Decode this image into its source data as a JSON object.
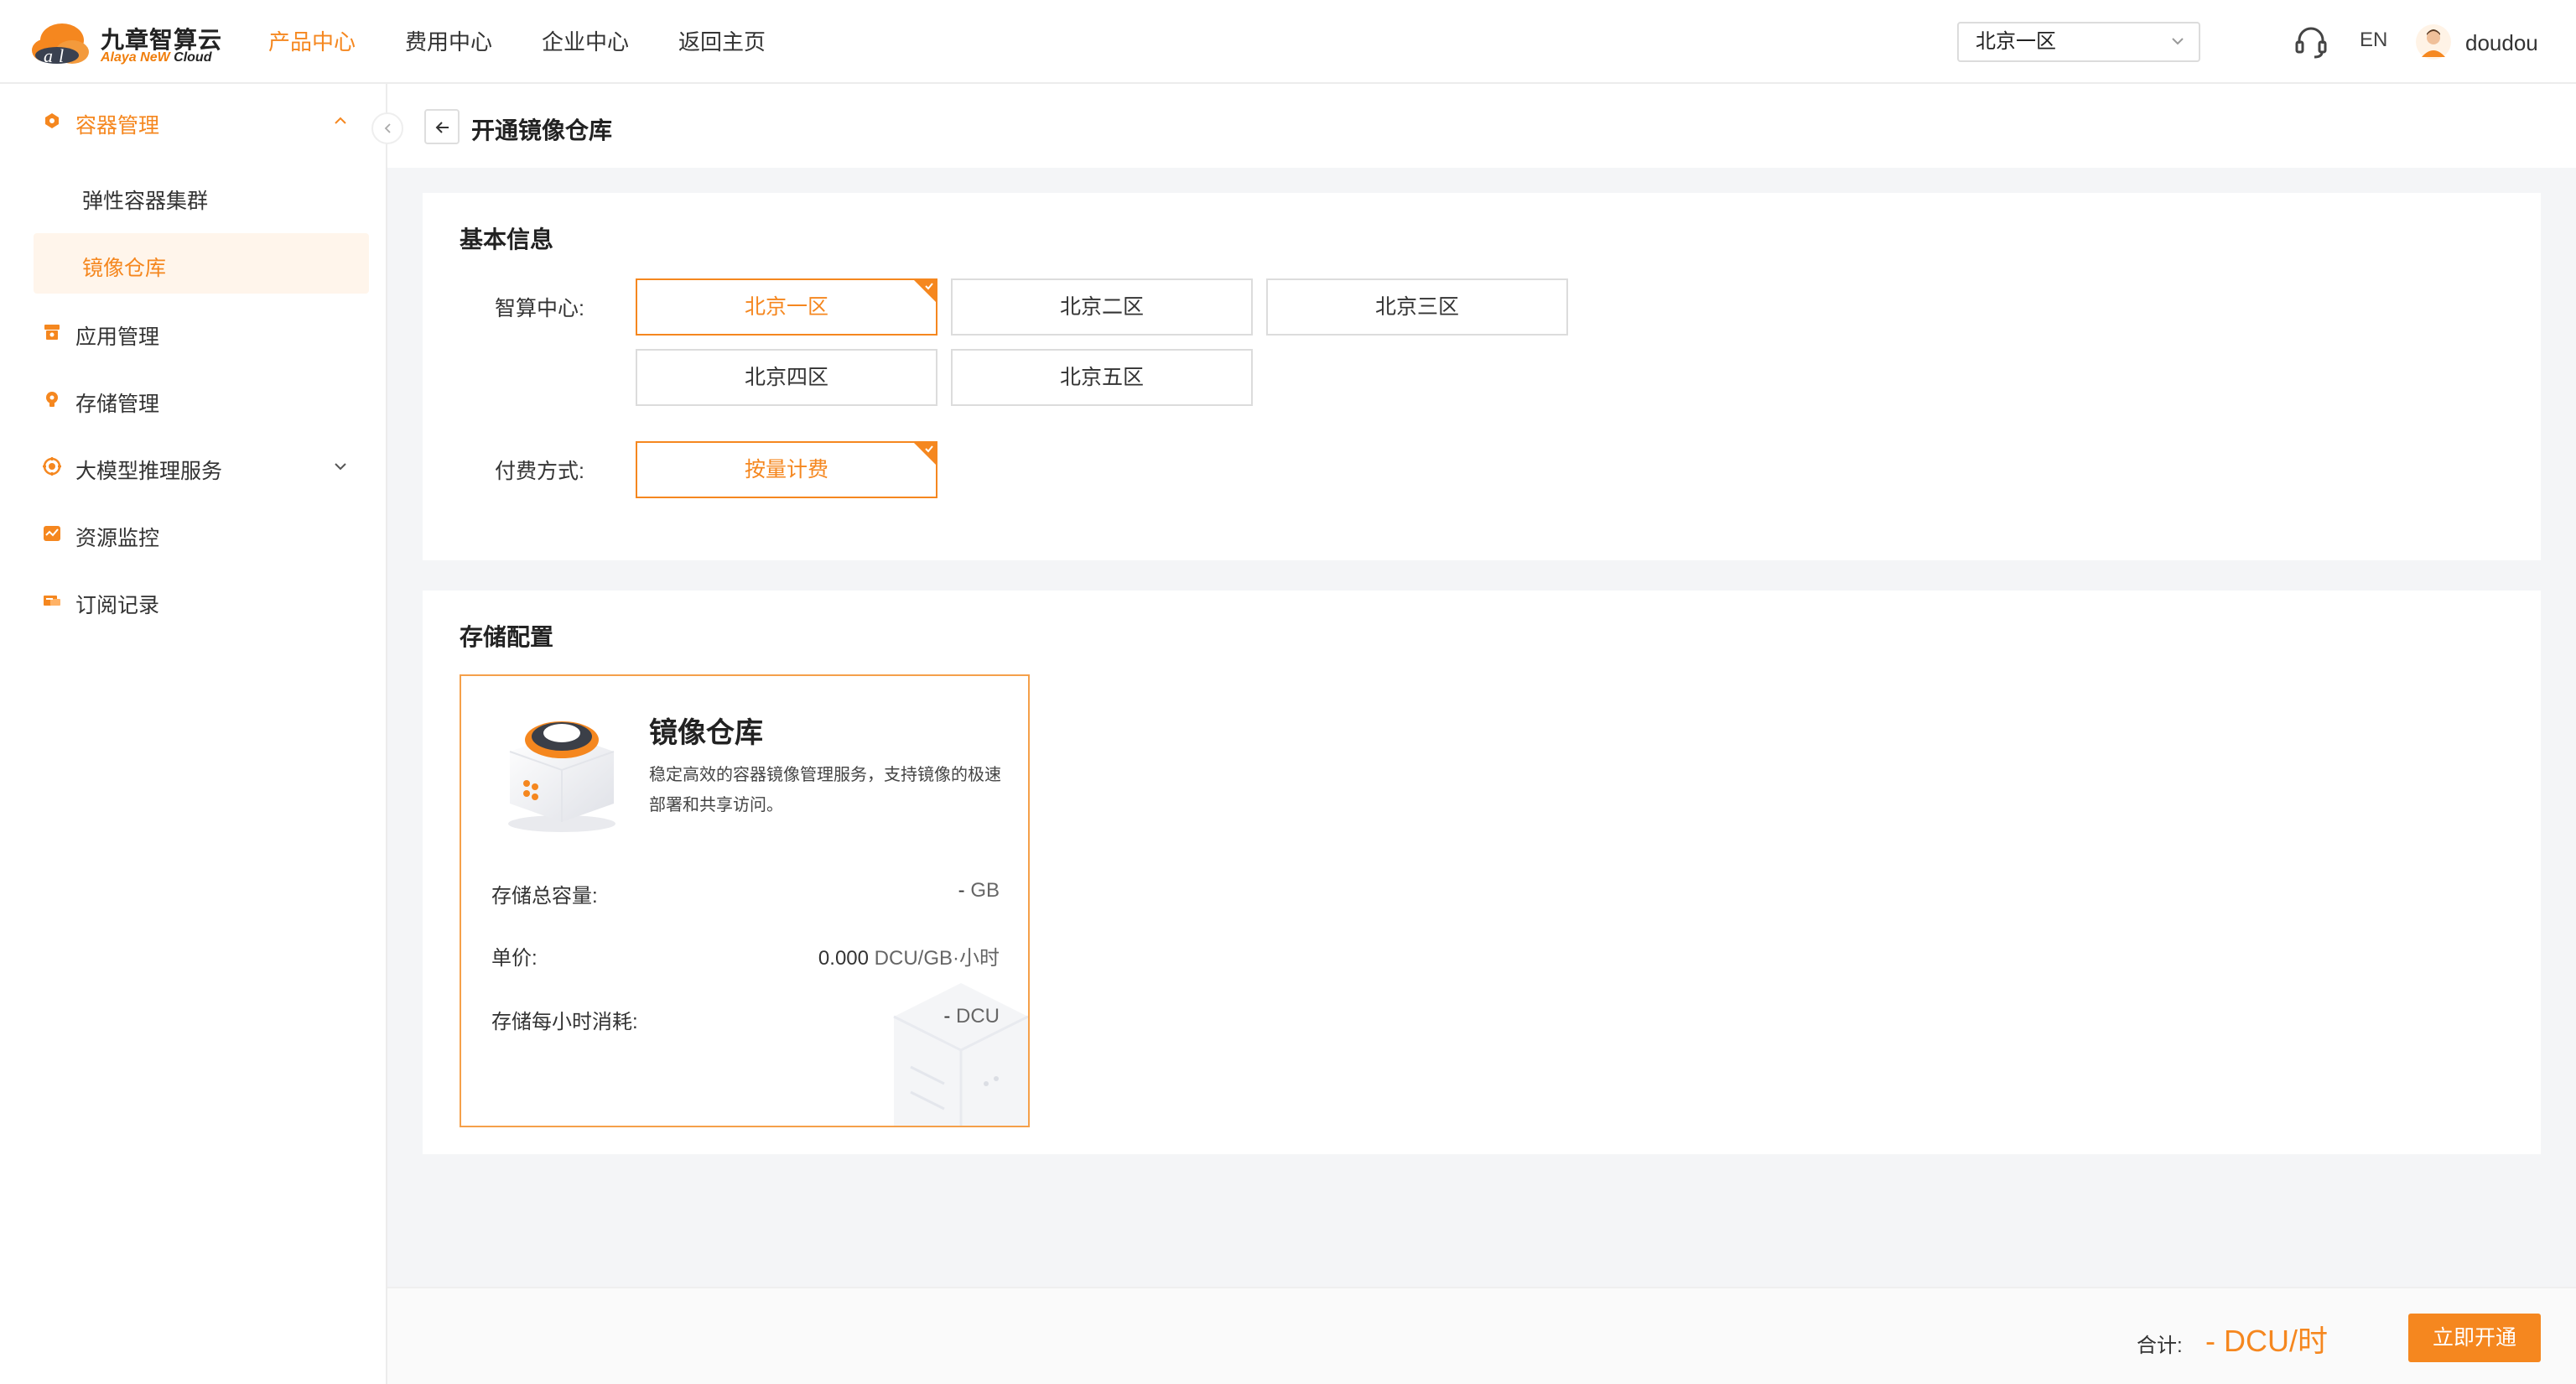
{
  "brand": {
    "name": "九章智算云",
    "en_name": "Alaya NeW",
    "en_suffix": "Cloud"
  },
  "topnav": [
    "产品中心",
    "费用中心",
    "企业中心",
    "返回主页"
  ],
  "topnav_active": "产品中心",
  "header": {
    "region": "北京一区",
    "lang": "EN",
    "user": "doudou"
  },
  "sidebar": {
    "groups": [
      {
        "label": "容器管理",
        "icon": "container-icon",
        "expanded": true,
        "items": [
          {
            "label": "弹性容器集群"
          },
          {
            "label": "镜像仓库",
            "active": true
          }
        ]
      },
      {
        "label": "应用管理",
        "icon": "app-icon"
      },
      {
        "label": "存储管理",
        "icon": "storage-icon"
      },
      {
        "label": "大模型推理服务",
        "icon": "model-icon",
        "expandable": true
      },
      {
        "label": "资源监控",
        "icon": "monitor-icon"
      },
      {
        "label": "订阅记录",
        "icon": "subscription-icon"
      }
    ]
  },
  "page": {
    "title": "开通镜像仓库"
  },
  "basic": {
    "title": "基本信息",
    "region_label": "智算中心:",
    "regions": [
      "北京一区",
      "北京二区",
      "北京三区",
      "北京四区",
      "北京五区"
    ],
    "selected_region": "北京一区",
    "pay_label": "付费方式:",
    "pay_options": [
      "按量计费"
    ],
    "selected_pay": "按量计费"
  },
  "storage": {
    "title": "存储配置",
    "product_name": "镜像仓库",
    "product_desc": "稳定高效的容器镜像管理服务，支持镜像的极速部署和共享访问。",
    "rows": [
      {
        "label": "存储总容量:",
        "value": "-",
        "unit": "GB"
      },
      {
        "label": "单价:",
        "value": "0.000",
        "unit": "DCU/GB·小时"
      },
      {
        "label": "存储每小时消耗:",
        "value": "-",
        "unit": "DCU"
      }
    ]
  },
  "footer": {
    "total_label": "合计:",
    "total_value": "- DCU/时",
    "submit_label": "立即开通"
  },
  "colors": {
    "accent": "#f5871f",
    "selected_bg": "#fff5eb",
    "page_bg": "#f4f5f7"
  }
}
